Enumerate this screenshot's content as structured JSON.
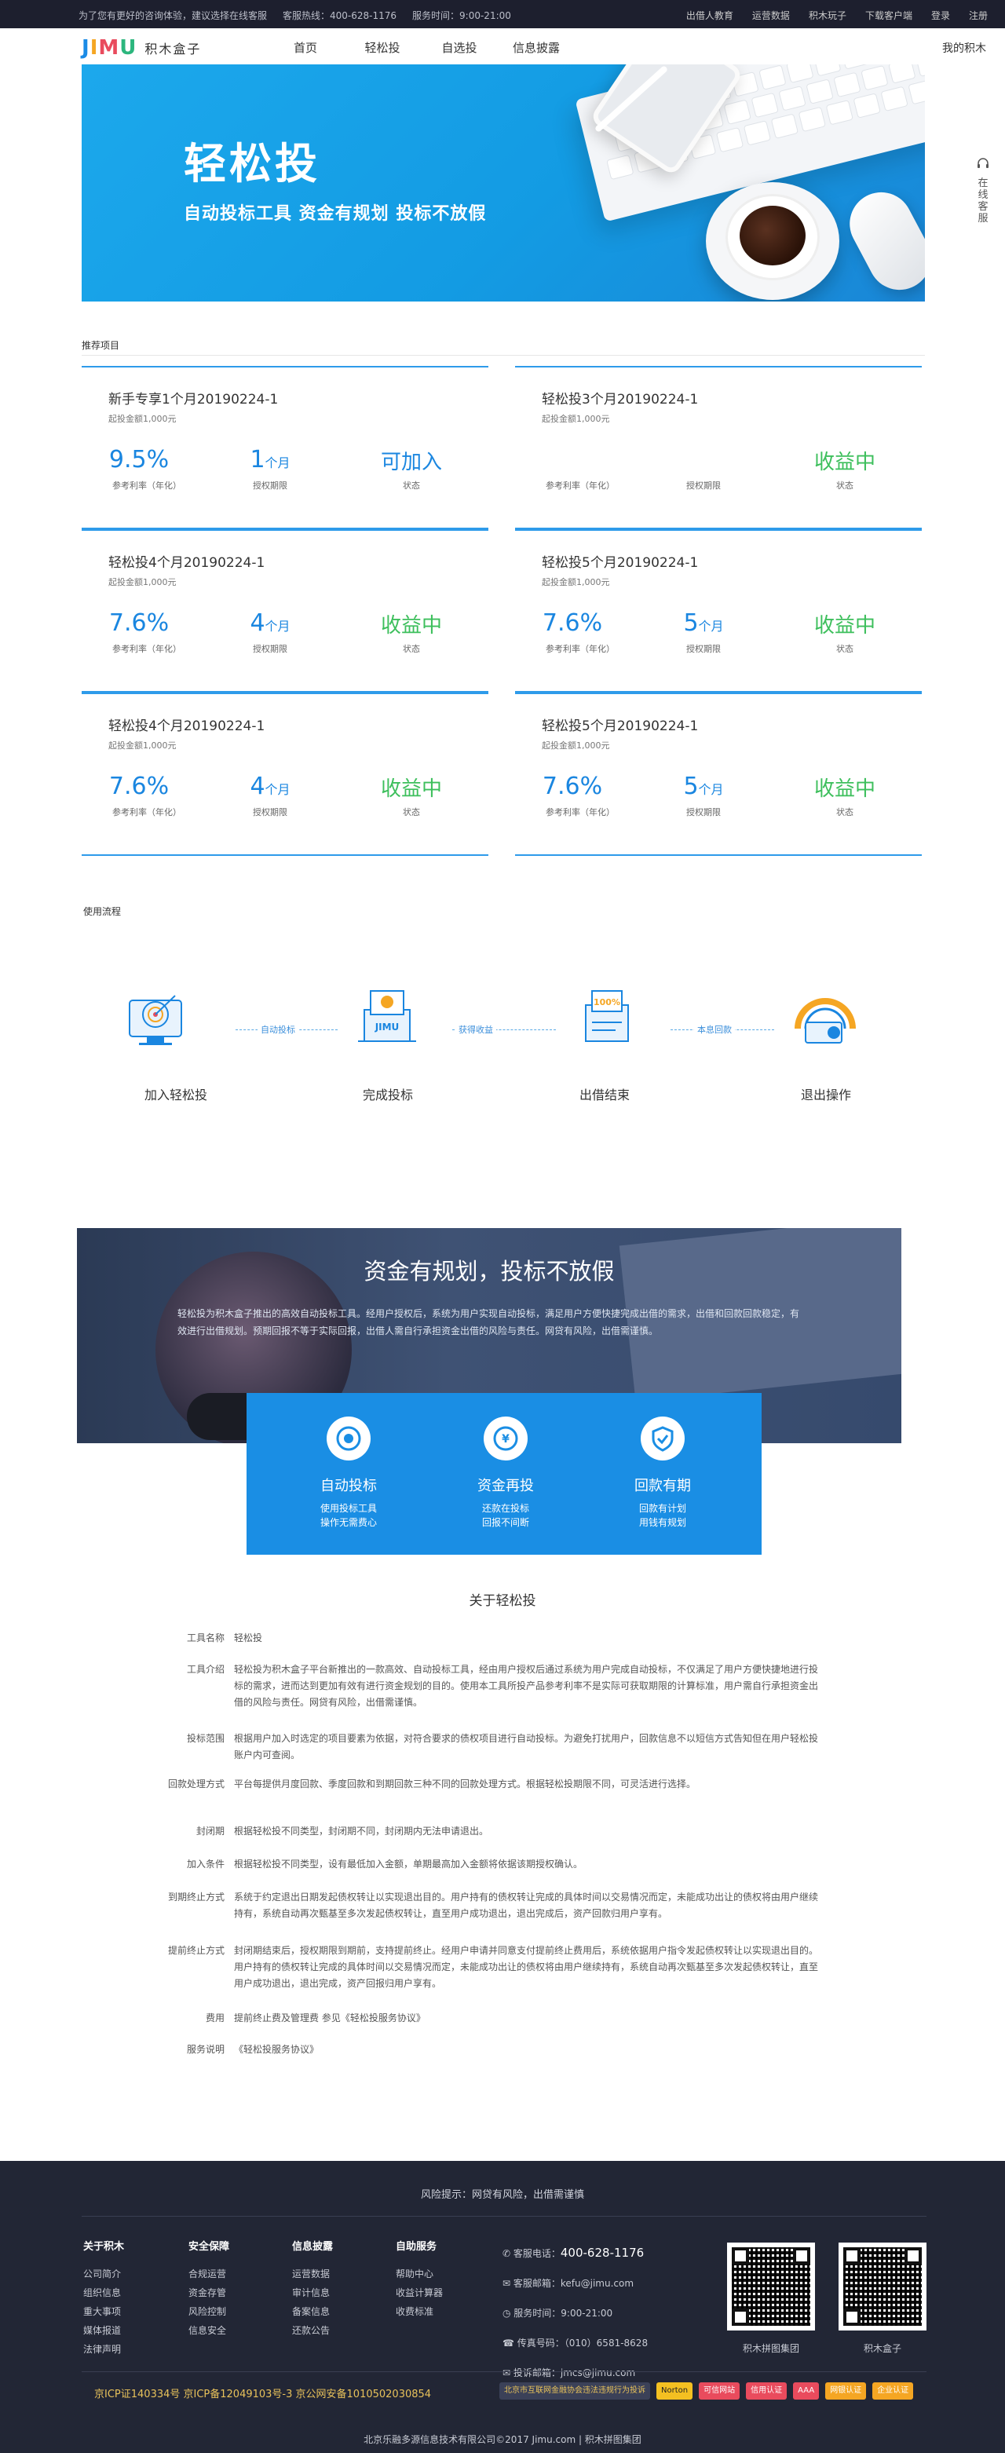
{
  "topbar": {
    "notice": "为了您有更好的咨询体验，建议选择在线客服",
    "hotline": "客服热线：400-628-1176",
    "service_time": "服务时间：9:00-21:00",
    "links": [
      "出借人教育",
      "运营数据",
      "积木玩子",
      "下载客户端",
      "登录",
      "注册"
    ]
  },
  "nav": {
    "logo_mark": "JIMU",
    "logo_text": "积木盒子",
    "menu": [
      "首页",
      "轻松投",
      "自选投",
      "信息披露"
    ],
    "my_account": "我的积木"
  },
  "banner": {
    "title": "轻松投",
    "subtitle": "自动投标工具  资金有规划  投标不放假"
  },
  "side_service": "在线客服",
  "recommend": {
    "label": "推荐项目",
    "cards": [
      {
        "name": "新手专享1个月20190224-1",
        "min": "起投金额1,000元",
        "rate": "9.5%",
        "rate_label": "参考利率（年化）",
        "period": "1",
        "period_unit": "个月",
        "period_label": "授权期限",
        "status": "可加入",
        "status_label": "状态",
        "status_color": "#1a86e0"
      },
      {
        "name": "轻松投3个月20190224-1",
        "min": "起投金额1,000元",
        "rate": "",
        "rate_label": "参考利率（年化）",
        "period": "",
        "period_unit": "",
        "period_label": "授权期限",
        "status": "收益中",
        "status_label": "状态",
        "status_color": "#3dbf5c"
      },
      {
        "name": "轻松投4个月20190224-1",
        "min": "起投金额1,000元",
        "rate": "7.6%",
        "rate_label": "参考利率（年化）",
        "period": "4",
        "period_unit": "个月",
        "period_label": "授权期限",
        "status": "收益中",
        "status_label": "状态",
        "status_color": "#3dbf5c"
      },
      {
        "name": "轻松投5个月20190224-1",
        "min": "起投金额1,000元",
        "rate": "7.6%",
        "rate_label": "参考利率（年化）",
        "period": "5",
        "period_unit": "个月",
        "period_label": "授权期限",
        "status": "收益中",
        "status_label": "状态",
        "status_color": "#3dbf5c"
      },
      {
        "name": "轻松投4个月20190224-1",
        "min": "起投金额1,000元",
        "rate": "7.6%",
        "rate_label": "参考利率（年化）",
        "period": "4",
        "period_unit": "个月",
        "period_label": "授权期限",
        "status": "收益中",
        "status_label": "状态",
        "status_color": "#3dbf5c"
      },
      {
        "name": "轻松投5个月20190224-1",
        "min": "起投金额1,000元",
        "rate": "7.6%",
        "rate_label": "参考利率（年化）",
        "period": "5",
        "period_unit": "个月",
        "period_label": "授权期限",
        "status": "收益中",
        "status_label": "状态",
        "status_color": "#3dbf5c"
      }
    ]
  },
  "flow": {
    "label": "使用流程",
    "steps": [
      "加入轻松投",
      "完成投标",
      "出借结束",
      "退出操作"
    ],
    "arrows": [
      "自动投标",
      "获得收益",
      "本息回款"
    ]
  },
  "band": {
    "title": "资金有规划，投标不放假",
    "desc": "轻松投为积木盒子推出的高效自动投标工具。经用户授权后，系统为用户实现自动投标，满足用户方便快捷完成出借的需求，出借和回款回款稳定，有效进行出借规划。预期回报不等于实际回报，出借人需自行承担资金出借的风险与责任。网贷有风险，出借需谨慎。",
    "features": [
      {
        "title": "自动投标",
        "line1": "使用投标工具",
        "line2": "操作无需费心",
        "icon": "target-icon"
      },
      {
        "title": "资金再投",
        "line1": "还款在投标",
        "line2": "回报不间断",
        "icon": "coin-icon"
      },
      {
        "title": "回款有期",
        "line1": "回款有计划",
        "line2": "用钱有规划",
        "icon": "shield-icon"
      }
    ]
  },
  "about": {
    "title": "关于轻松投",
    "rows": [
      {
        "k": "工具名称",
        "v": "轻松投"
      },
      {
        "k": "工具介绍",
        "v": "轻松投为积木盒子平台新推出的一款高效、自动投标工具，经由用户授权后通过系统为用户完成自动投标，不仅满足了用户方便快捷地进行投标的需求，进而达到更加有效有进行资金规划的目的。使用本工具所投产品参考利率不是实际可获取期限的计算标准，用户需自行承担资金出借的风险与责任。网贷有风险，出借需谨慎。"
      },
      {
        "k": "投标范围",
        "v": "根据用户加入时选定的项目要素为依据，对符合要求的债权项目进行自动投标。为避免打扰用户，回款信息不以短信方式告知但在用户轻松投账户内可查阅。"
      },
      {
        "k": "回款处理方式",
        "v": "平台每提供月度回款、季度回款和到期回款三种不同的回款处理方式。根据轻松投期限不同，可灵活进行选择。"
      },
      {
        "k": "封闭期",
        "v": "根据轻松投不同类型，封闭期不同，封闭期内无法申请退出。"
      },
      {
        "k": "加入条件",
        "v": "根据轻松投不同类型，设有最低加入金额，单期最高加入金额将依据该期授权确认。"
      },
      {
        "k": "到期终止方式",
        "v": "系统于约定退出日期发起债权转让以实现退出目的。用户持有的债权转让完成的具体时间以交易情况而定，未能成功出让的债权将由用户继续持有，系统自动再次甄基至多次发起债权转让，直至用户成功退出，退出完成后，资产回款归用户享有。"
      },
      {
        "k": "提前终止方式",
        "v": "封闭期结束后，授权期限到期前，支持提前终止。经用户申请并同意支付提前终止费用后，系统依据用户指令发起债权转让以实现退出目的。用户持有的债权转让完成的具体时间以交易情况而定，未能成功出让的债权将由用户继续持有，系统自动再次甄基至多次发起债权转让，直至用户成功退出，退出完成，资产回报归用户享有。"
      },
      {
        "k": "费用",
        "v": "提前终止费及管理费 参见《轻松投服务协议》"
      },
      {
        "k": "服务说明",
        "v": "《轻松投服务协议》"
      }
    ]
  },
  "footer": {
    "risk": "风险提示：网贷有风险，出借需谨慎",
    "cols": [
      {
        "h": "关于积木",
        "items": [
          "公司简介",
          "组织信息",
          "重大事项",
          "媒体报道",
          "法律声明"
        ]
      },
      {
        "h": "安全保障",
        "items": [
          "合规运营",
          "资金存管",
          "风险控制",
          "信息安全"
        ]
      },
      {
        "h": "信息披露",
        "items": [
          "运营数据",
          "审计信息",
          "备案信息",
          "还款公告"
        ]
      },
      {
        "h": "自助服务",
        "items": [
          "帮助中心",
          "收益计算器",
          "收费标准"
        ]
      }
    ],
    "contact": {
      "phone_label": "客服电话：",
      "phone": "400-628-1176",
      "email": "客服邮箱：kefu@jimu.com",
      "time": "服务时间：9:00-21:00",
      "fax": "传真号码：（010）6581-8628",
      "complaint": "投诉邮箱：jmcs@jimu.com"
    },
    "qr_labels": [
      "积木拼图集团",
      "积木盒子"
    ],
    "icp": "京ICP证140334号  京ICP备12049103号-3  京公网安备1010502030854",
    "badges": [
      "北京市互联网金融协会违法违规行为投诉",
      "Norton",
      "可信网站",
      "信用认证",
      "AAA",
      "网银认证",
      "企业认证"
    ],
    "copyright": "北京乐融多源信息技术有限公司©2017  Jimu.com  |  积木拼图集团"
  },
  "colors": {
    "accent": "#1a8ee4",
    "green": "#3dbf5c",
    "footer_bg": "#222635",
    "topbar_bg": "#1d1f2e"
  }
}
